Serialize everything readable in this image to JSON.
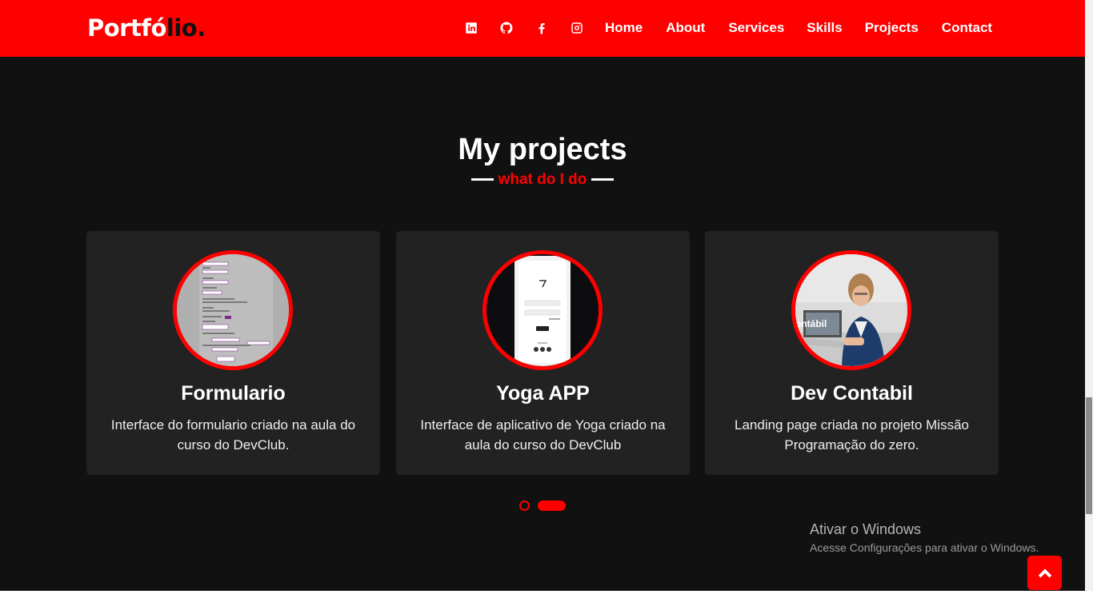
{
  "navbar": {
    "logo": {
      "main": "Portfó",
      "accent": "lio."
    },
    "social_icons": [
      "linkedin-icon",
      "github-icon",
      "facebook-icon",
      "instagram-icon"
    ],
    "links": [
      "Home",
      "About",
      "Services",
      "Skills",
      "Projects",
      "Contact"
    ]
  },
  "projects": {
    "title": "My projects",
    "subtitle": "what do I do",
    "cards": [
      {
        "title": "Formulario",
        "description": "Interface do formulario criado na aula do curso do DevClub."
      },
      {
        "title": "Yoga APP",
        "description": "Interface de aplicativo de Yoga criado na aula do curso do DevClub"
      },
      {
        "title": "Dev Contabil",
        "description": "Landing page criada no projeto Missão Programação do zero."
      }
    ],
    "thumb_text": {
      "contabil": "ontábil"
    }
  },
  "watermark": {
    "line1": "Ativar o Windows",
    "line2": "Acesse Configurações para ativar o Windows."
  },
  "colors": {
    "accent": "#ff0000",
    "background": "#111111",
    "card": "#222222"
  }
}
